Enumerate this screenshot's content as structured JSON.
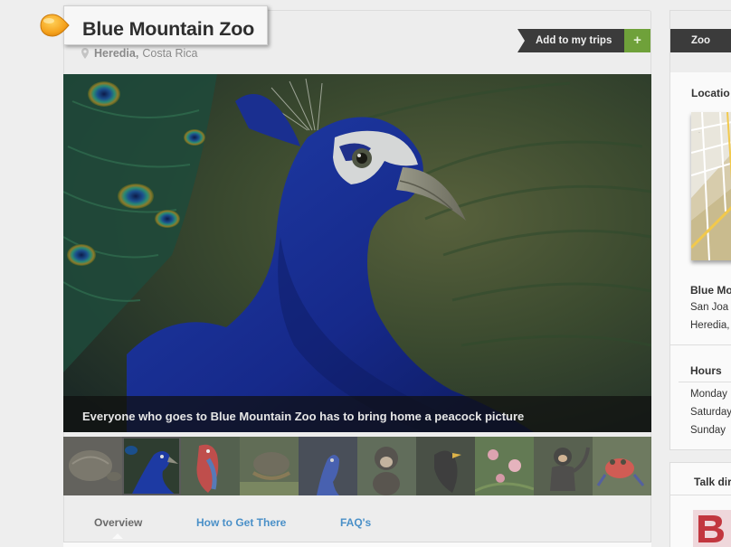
{
  "place": {
    "title": "Blue Mountain Zoo",
    "city": "Heredia,",
    "country": "Costa Rica"
  },
  "actions": {
    "add_trips_label": "Add to my trips",
    "add_trips_icon": "+"
  },
  "hero": {
    "caption": "Everyone who goes to Blue Mountain Zoo has to bring home a peacock picture"
  },
  "thumbnails": [
    {
      "subject": "tortoise"
    },
    {
      "subject": "peacock",
      "active": true
    },
    {
      "subject": "parrot"
    },
    {
      "subject": "turtle"
    },
    {
      "subject": "peacock-blue"
    },
    {
      "subject": "monkey"
    },
    {
      "subject": "blackbird"
    },
    {
      "subject": "flowers"
    },
    {
      "subject": "spider-monkey"
    },
    {
      "subject": "frog"
    }
  ],
  "tabs": [
    {
      "label": "Overview",
      "active": true
    },
    {
      "label": "How to Get There",
      "active": false
    },
    {
      "label": "FAQ's",
      "active": false
    }
  ],
  "sidebar": {
    "category": "Zoo",
    "location_title": "Locatio",
    "address_name": "Blue Mo",
    "address_line1": "San Joa",
    "address_line2": "Heredia,",
    "hours_title": "Hours",
    "hours_days": [
      "Monday",
      "Saturday",
      "Sunday"
    ],
    "talk_title": "Talk dir"
  },
  "colors": {
    "background": "#eeeeee",
    "dark_label": "#3b3b3b",
    "add_green": "#6fa13a",
    "link_blue": "#4a90c8",
    "marker_orange": "#f5a623"
  }
}
